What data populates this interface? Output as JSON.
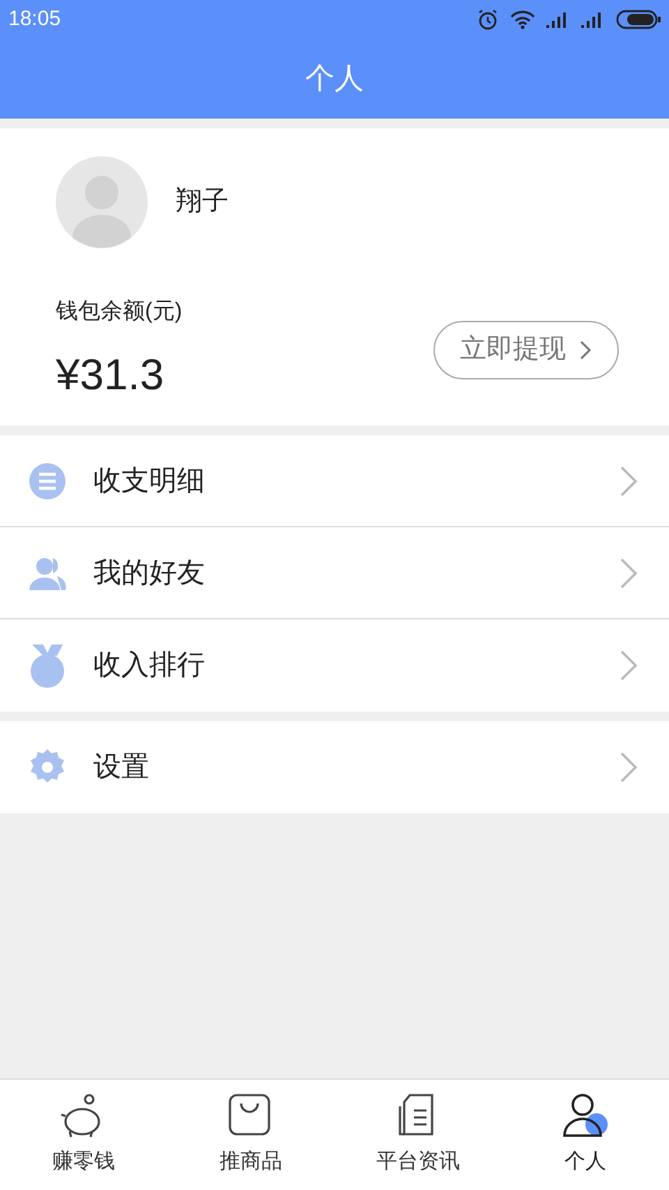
{
  "status_bar": {
    "time": "18:05"
  },
  "header": {
    "title": "个人"
  },
  "profile": {
    "name": "翔子",
    "balance_label": "钱包余额(元)",
    "balance": "¥31.3",
    "withdraw_button": "立即提现"
  },
  "menu_groups": [
    [
      {
        "kind": "list",
        "label": "收支明细"
      },
      {
        "kind": "friends",
        "label": "我的好友"
      },
      {
        "kind": "medal",
        "label": "收入排行"
      }
    ],
    [
      {
        "kind": "gear",
        "label": "设置"
      }
    ]
  ],
  "tab_bar": [
    {
      "kind": "piggy",
      "label": "赚零钱",
      "selected": false
    },
    {
      "kind": "bag",
      "label": "推商品",
      "selected": false
    },
    {
      "kind": "doc",
      "label": "平台资讯",
      "selected": false
    },
    {
      "kind": "person",
      "label": "个人",
      "selected": true
    }
  ]
}
